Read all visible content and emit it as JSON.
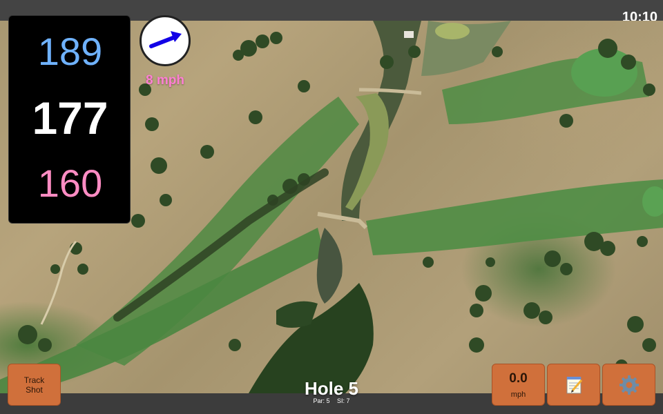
{
  "status": {
    "time": "10:10"
  },
  "distances": {
    "back": "189",
    "middle": "177",
    "front": "160"
  },
  "wind": {
    "label": "8 mph",
    "icon": "wind-arrow-icon",
    "direction": "north-east"
  },
  "hole": {
    "title": "Hole 5",
    "par": "Par: 5",
    "si": "SI: 7"
  },
  "buttons": {
    "track_shot_line1": "Track",
    "track_shot_line2": "Shot",
    "speed_value": "0.0",
    "speed_unit": "mph",
    "notes_icon": "notepad-icon",
    "settings_icon": "gear-icon"
  },
  "colors": {
    "back": "#6fb2ff",
    "middle": "#ffffff",
    "front": "#ff8cc3",
    "wind_label": "#ff7fd4",
    "button": "#d0703b"
  }
}
